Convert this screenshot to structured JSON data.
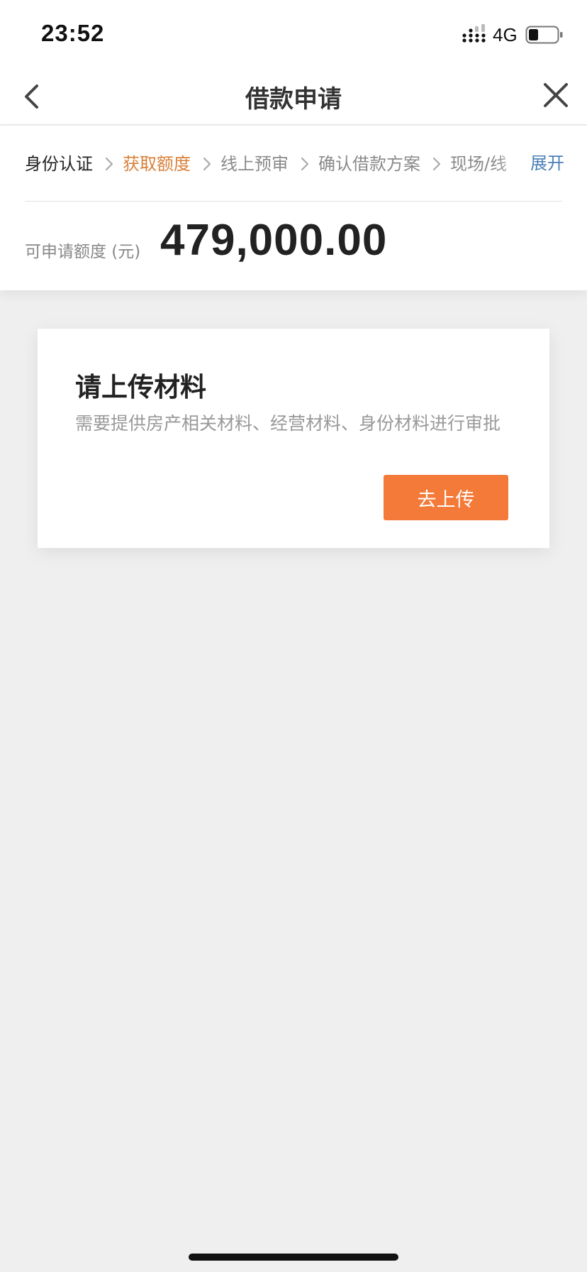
{
  "status_bar": {
    "time": "23:52",
    "network": "4G",
    "icons": [
      "signal-icon",
      "battery-icon"
    ]
  },
  "nav": {
    "title": "借款申请",
    "back_icon": "chevron-left-icon",
    "close_icon": "close-icon"
  },
  "steps": {
    "items": [
      {
        "label": "身份认证",
        "state": "done"
      },
      {
        "label": "获取额度",
        "state": "active"
      },
      {
        "label": "线上预审",
        "state": "todo"
      },
      {
        "label": "确认借款方案",
        "state": "todo"
      },
      {
        "label": "现场/线",
        "state": "todo"
      }
    ],
    "expand_label": "展开"
  },
  "quota": {
    "label": "可申请额度 (元)",
    "amount": "479,000.00"
  },
  "upload_card": {
    "title": "请上传材料",
    "description": "需要提供房产相关材料、经营材料、身份材料进行审批",
    "button_label": "去上传"
  },
  "colors": {
    "accent": "#f47a39",
    "active_step": "#d9803a",
    "link": "#4a7fb6",
    "page_background": "#efefef"
  }
}
